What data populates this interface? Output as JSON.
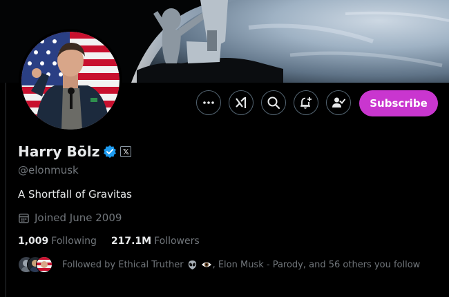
{
  "profile": {
    "display_name": "Harry Bōlz",
    "handle": "@elonmusk",
    "bio": "A Shortfall of Gravitas",
    "joined": "Joined June 2009",
    "badge_letter": "𝕏"
  },
  "actions": {
    "subscribe_label": "Subscribe"
  },
  "stats": {
    "following_count": "1,009",
    "following_label": "Following",
    "followers_count": "217.1M",
    "followers_label": "Followers"
  },
  "followed_by": {
    "prefix": "Followed by Ethical Truther",
    "suffix": ", Elon Musk - Parody, and 56 others you follow"
  },
  "colors": {
    "accent": "#c936cf",
    "verified": "#1d9bf0",
    "muted": "#71767b",
    "text": "#e7e9ea"
  },
  "icons": [
    "more-icon",
    "grok-icon",
    "search-icon",
    "notify-plus-icon",
    "follow-check-icon",
    "verified-icon",
    "calendar-icon",
    "alien-emoji-icon",
    "eye-emoji-icon"
  ]
}
